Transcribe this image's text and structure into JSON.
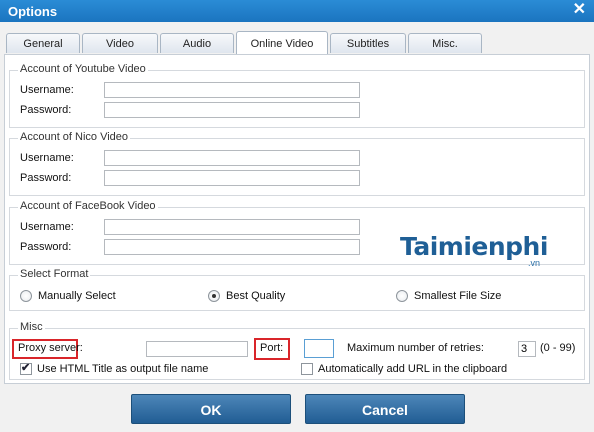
{
  "window": {
    "title": "Options",
    "close_glyph": "✕"
  },
  "tabs": [
    {
      "label": "General"
    },
    {
      "label": "Video"
    },
    {
      "label": "Audio"
    },
    {
      "label": "Online Video",
      "active": true
    },
    {
      "label": "Subtitles"
    },
    {
      "label": "Misc."
    }
  ],
  "youtube": {
    "legend": "Account of Youtube Video",
    "username_label": "Username:",
    "password_label": "Password:",
    "username_value": "",
    "password_value": ""
  },
  "nico": {
    "legend": "Account of Nico Video",
    "username_label": "Username:",
    "password_label": "Password:",
    "username_value": "",
    "password_value": ""
  },
  "facebook": {
    "legend": "Account of FaceBook Video",
    "username_label": "Username:",
    "password_label": "Password:",
    "username_value": "",
    "password_value": ""
  },
  "format": {
    "legend": "Select Format",
    "options": [
      {
        "label": "Manually Select",
        "checked": false
      },
      {
        "label": "Best Quality",
        "checked": true
      },
      {
        "label": "Smallest File Size",
        "checked": false
      }
    ]
  },
  "misc": {
    "legend": "Misc",
    "proxy_label": "Proxy server:",
    "proxy_value": "",
    "port_label": "Port:",
    "port_value": "",
    "retries_label": "Maximum number of retries:",
    "retries_value": "3",
    "retries_range": "(0 - 99)",
    "html_title_label": "Use HTML Title as output file name",
    "html_title_checked": true,
    "auto_url_label": "Automatically add URL in the clipboard",
    "auto_url_checked": false,
    "highlight_color": "#d9252a"
  },
  "buttons": {
    "ok": "OK",
    "cancel": "Cancel"
  },
  "watermark": {
    "brand": "Taimienphi",
    "suffix": ".vn"
  },
  "colors": {
    "title_bar": "#1b74bf",
    "button": "#215d94"
  }
}
